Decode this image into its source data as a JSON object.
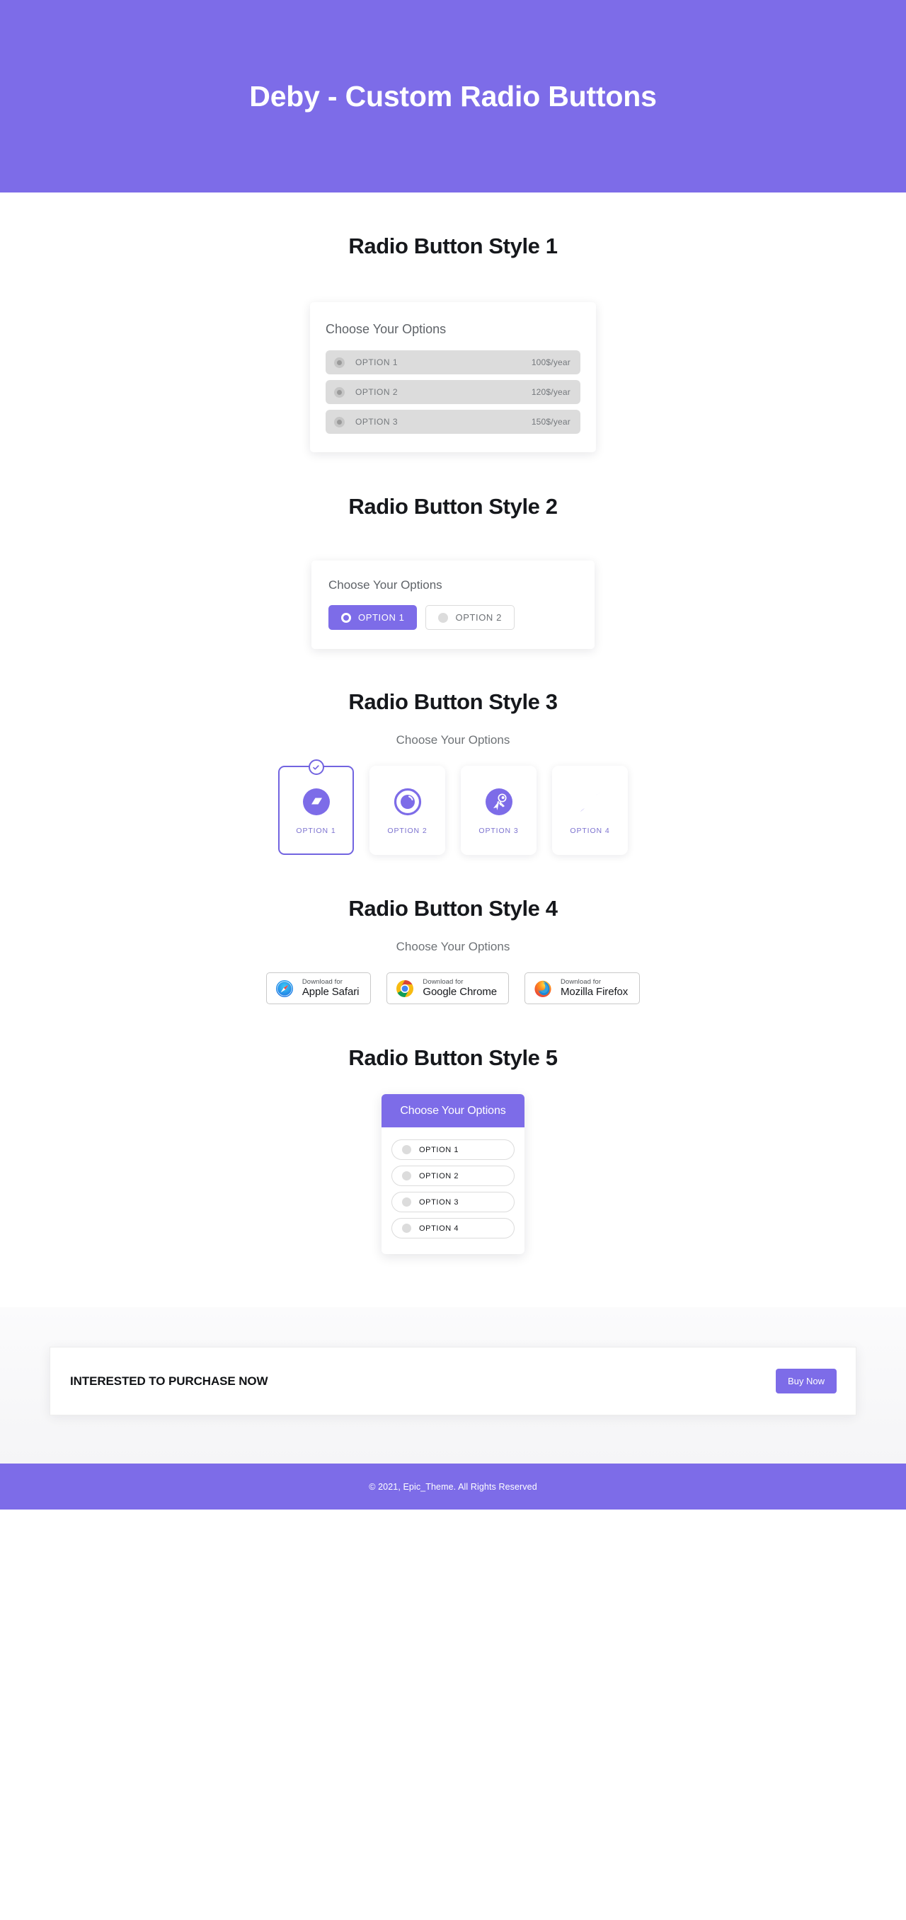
{
  "header": {
    "title": "Deby - Custom Radio Buttons"
  },
  "colors": {
    "brand_purple": "#7d6ce8",
    "selected_border": "#7264e0",
    "row_gray": "#dcdcdc",
    "heading_dark": "#16181c",
    "muted_text": "#6e7276"
  },
  "style1": {
    "section_title": "Radio Button Style 1",
    "card_heading": "Choose Your Options",
    "options": [
      {
        "label": "OPTION 1",
        "price": "100$/year",
        "selected": false
      },
      {
        "label": "OPTION 2",
        "price": "120$/year",
        "selected": false
      },
      {
        "label": "OPTION 3",
        "price": "150$/year",
        "selected": false
      }
    ]
  },
  "style2": {
    "section_title": "Radio Button Style 2",
    "card_heading": "Choose Your Options",
    "options": [
      {
        "label": "OPTION 1",
        "selected": true
      },
      {
        "label": "OPTION 2",
        "selected": false
      }
    ]
  },
  "style3": {
    "section_title": "Radio Button Style 3",
    "subtitle": "Choose Your Options",
    "options": [
      {
        "label": "OPTION 1",
        "icon": "parallelogram-badge-icon",
        "selected": true
      },
      {
        "label": "OPTION 2",
        "icon": "aperture-circle-icon",
        "selected": false
      },
      {
        "label": "OPTION 3",
        "icon": "astronaut-badge-icon",
        "selected": false
      },
      {
        "label": "OPTION 4",
        "icon": "leaf-loop-icon",
        "selected": false
      }
    ]
  },
  "style4": {
    "section_title": "Radio Button Style 4",
    "subtitle": "Choose Your Options",
    "options": [
      {
        "small": "Download for",
        "big": "Apple Safari",
        "icon": "safari-icon",
        "selected": false
      },
      {
        "small": "Download for",
        "big": "Google Chrome",
        "icon": "chrome-icon",
        "selected": false
      },
      {
        "small": "Download for",
        "big": "Mozilla Firefox",
        "icon": "firefox-icon",
        "selected": false
      }
    ]
  },
  "style5": {
    "section_title": "Radio Button Style 5",
    "card_heading": "Choose Your Options",
    "options": [
      {
        "label": "OPTION 1",
        "selected": false
      },
      {
        "label": "OPTION 2",
        "selected": false
      },
      {
        "label": "OPTION 3",
        "selected": false
      },
      {
        "label": "OPTION 4",
        "selected": false
      }
    ]
  },
  "cta": {
    "text": "INTERESTED TO PURCHASE NOW",
    "button_label": "Buy Now"
  },
  "footer": {
    "copyright": "© 2021, Epic_Theme. All Rights Reserved"
  }
}
